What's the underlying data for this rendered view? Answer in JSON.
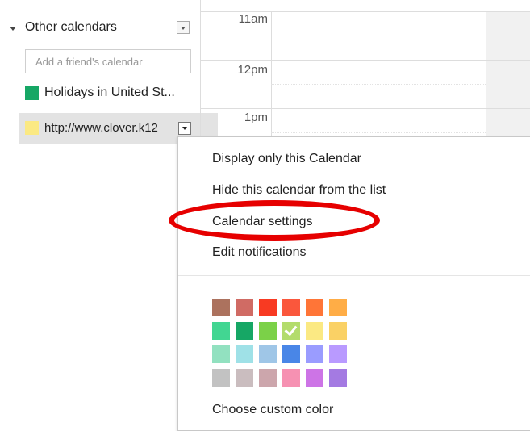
{
  "sidebar": {
    "section_title": "Other calendars",
    "friend_input_placeholder": "Add a friend's calendar",
    "calendars": [
      {
        "label": "Holidays in United St...",
        "color": "#16a765"
      },
      {
        "label": "http://www.clover.k12",
        "color": "#fbe983"
      }
    ]
  },
  "grid": {
    "times": [
      "11am",
      "12pm",
      "1pm"
    ]
  },
  "menu": {
    "items": [
      "Display only this Calendar",
      "Hide this calendar from the list",
      "Calendar settings",
      "Edit notifications"
    ],
    "custom_color_label": "Choose custom color",
    "selected_color": "#b3dc6c",
    "colors": [
      [
        "#ac725e",
        "#d06b64",
        "#f83a22",
        "#fa573c",
        "#ff7537",
        "#ffad46"
      ],
      [
        "#42d692",
        "#16a765",
        "#7bd148",
        "#b3dc6c",
        "#fbe983",
        "#fad165"
      ],
      [
        "#92e1c0",
        "#9fe1e7",
        "#9fc6e7",
        "#4986e7",
        "#9a9cff",
        "#b99aff"
      ],
      [
        "#c2c2c2",
        "#cabdbf",
        "#cca6ac",
        "#f691b2",
        "#cd74e6",
        "#a47ae2"
      ]
    ]
  },
  "annotation": {
    "color": "#e60000"
  }
}
